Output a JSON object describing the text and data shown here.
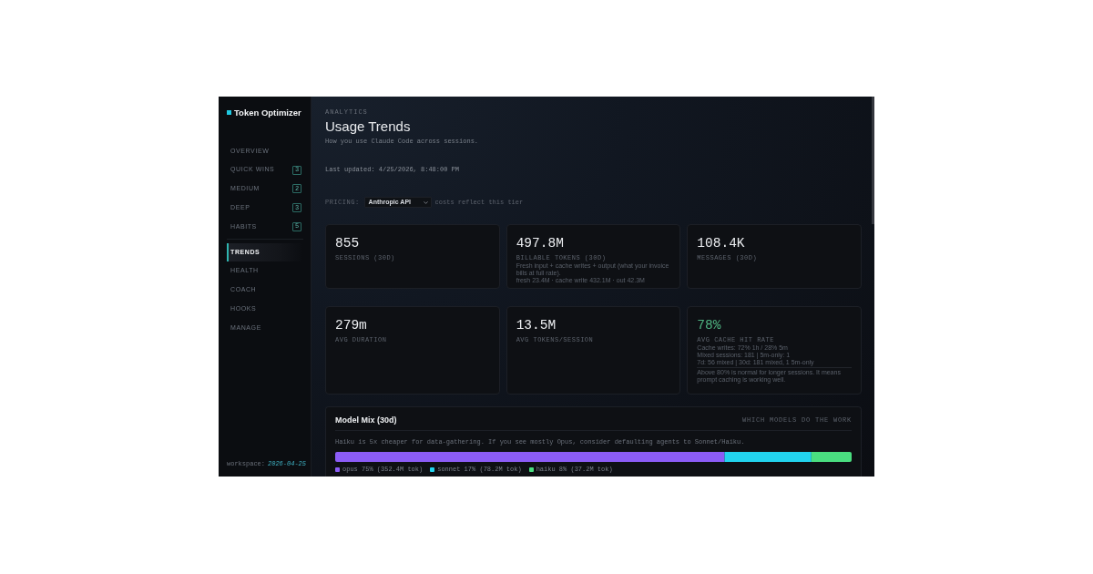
{
  "sidebar": {
    "brand": "Token Optimizer",
    "nav_groups": [
      {
        "items": [
          {
            "label": "OVERVIEW",
            "selected": false
          },
          {
            "label": "QUICK WINS",
            "badge": "3",
            "selected": false
          },
          {
            "label": "MEDIUM",
            "badge": "2",
            "selected": false
          },
          {
            "label": "DEEP",
            "badge": "3",
            "selected": false
          },
          {
            "label": "HABITS",
            "badge": "5",
            "selected": false
          }
        ]
      },
      {
        "items": [
          {
            "label": "TRENDS",
            "selected": true
          },
          {
            "label": "HEALTH",
            "selected": false
          },
          {
            "label": "COACH",
            "selected": false
          },
          {
            "label": "HOOKS",
            "selected": false
          },
          {
            "label": "MANAGE",
            "selected": false
          }
        ]
      }
    ],
    "workspace": {
      "label": "workspace:",
      "value": "2026-04-25"
    }
  },
  "header": {
    "eyebrow": "ANALYTICS",
    "title": "Usage Trends",
    "subtitle": "How you use Claude Code across sessions.",
    "last_updated": "Last updated: 4/25/2026, 8:48:00 PM"
  },
  "pricing": {
    "label": "PRICING:",
    "value": "Anthropic API",
    "hint": "costs reflect this tier"
  },
  "stats": [
    {
      "value": "855",
      "label": "SESSIONS (30D)",
      "highlighted": false
    },
    {
      "value": "497.8M",
      "label": "BILLABLE TOKENS (30D)",
      "highlighted": false,
      "notes": [
        "Fresh input + cache writes + output (what your invoice bills at full rate).",
        "fresh 23.4M · cache write 432.1M · out 42.3M"
      ]
    },
    {
      "value": "108.4K",
      "label": "MESSAGES (30D)",
      "highlighted": false
    },
    {
      "value": "279m",
      "label": "AVG DURATION",
      "highlighted": false
    },
    {
      "value": "13.5M",
      "label": "AVG TOKENS/SESSION",
      "highlighted": false
    },
    {
      "value": "78%",
      "label": "AVG CACHE HIT RATE",
      "highlighted": true,
      "notes": [
        "Cache writes: 72% 1h / 28% 5m",
        "Mixed sessions: 181 | 5m-only: 1",
        "7d: 56 mixed | 30d: 181 mixed, 1 5m-only"
      ],
      "footnote": "Above 80% is normal for longer sessions. It means prompt caching is working well."
    }
  ],
  "model_mix": {
    "title": "Model Mix (30d)",
    "tag": "WHICH MODELS DO THE WORK",
    "tip": "Haiku is 5x cheaper for data-gathering. If you see mostly Opus, consider defaulting agents to Sonnet/Haiku.",
    "models": [
      {
        "legend": "opus 75% (352.4M tok)",
        "color": "#8b5cf6"
      },
      {
        "legend": "sonnet 17% (78.2M tok)",
        "color": "#22d3ee"
      },
      {
        "legend": "haiku 8% (37.2M tok)",
        "color": "#4ade80"
      }
    ]
  }
}
